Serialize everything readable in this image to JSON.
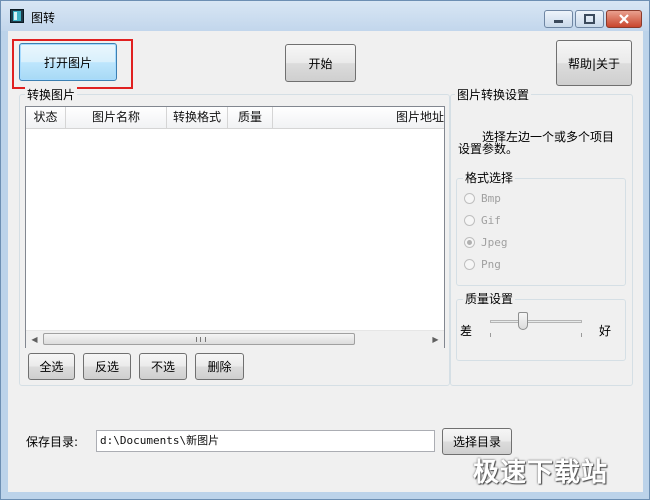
{
  "window": {
    "title": "图转",
    "icon": "app-image-icon",
    "controls": [
      "minimize-icon",
      "maximize-icon",
      "close-icon"
    ]
  },
  "toolbar": {
    "open_label": "打开图片",
    "start_label": "开始",
    "help_label": "帮助|关于"
  },
  "convert_list": {
    "group_title": "转换图片",
    "columns": [
      "状态",
      "图片名称",
      "转换格式",
      "质量",
      "图片地址"
    ],
    "rows": [],
    "select_all_label": "全选",
    "invert_label": "反选",
    "select_none_label": "不选",
    "delete_label": "删除"
  },
  "settings": {
    "group_title": "图片转换设置",
    "hint_line1": "选择左边一个或多个项目",
    "hint_line2": "设置参数。",
    "format": {
      "group_title": "格式选择",
      "options": [
        "Bmp",
        "Gif",
        "Jpeg",
        "Png"
      ],
      "selected": "Jpeg"
    },
    "quality": {
      "group_title": "质量设置",
      "low_label": "差",
      "high_label": "好",
      "level": 0.4
    }
  },
  "save": {
    "label": "保存目录:",
    "path": "d:\\Documents\\新图片",
    "browse_label": "选择目录"
  },
  "watermark": "极速下载站",
  "colors": {
    "highlight_box": "#e02020",
    "close_button": "#c9452c"
  }
}
